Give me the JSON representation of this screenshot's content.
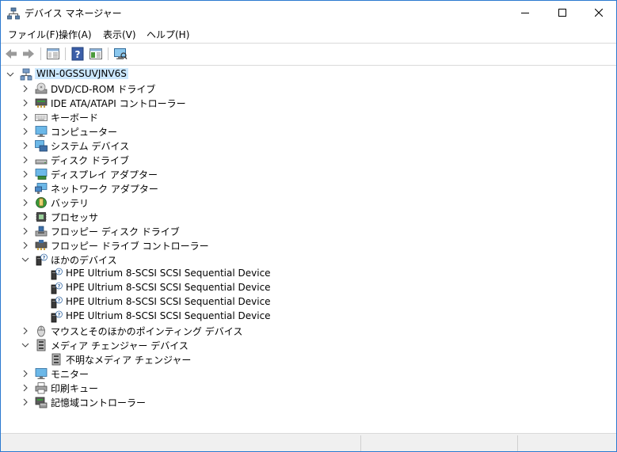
{
  "window": {
    "title": "デバイス マネージャー"
  },
  "menu": [
    "ファイル(F)",
    "操作(A)",
    "表示(V)",
    "ヘルプ(H)"
  ],
  "tree": {
    "root": "WIN-0GSSUVJNV6S",
    "items": [
      {
        "label": "DVD/CD-ROM ドライブ",
        "icon": "dvd-drive-icon",
        "expanded": false
      },
      {
        "label": "IDE ATA/ATAPI コントローラー",
        "icon": "ide-controller-icon",
        "expanded": false
      },
      {
        "label": "キーボード",
        "icon": "keyboard-icon",
        "expanded": false
      },
      {
        "label": "コンピューター",
        "icon": "computer-icon",
        "expanded": false
      },
      {
        "label": "システム デバイス",
        "icon": "system-devices-icon",
        "expanded": false
      },
      {
        "label": "ディスク ドライブ",
        "icon": "disk-drive-icon",
        "expanded": false
      },
      {
        "label": "ディスプレイ アダプター",
        "icon": "display-adapter-icon",
        "expanded": false
      },
      {
        "label": "ネットワーク アダプター",
        "icon": "network-adapter-icon",
        "expanded": false
      },
      {
        "label": "バッテリ",
        "icon": "battery-icon",
        "expanded": false
      },
      {
        "label": "プロセッサ",
        "icon": "processor-icon",
        "expanded": false
      },
      {
        "label": "フロッピー ディスク ドライブ",
        "icon": "floppy-drive-icon",
        "expanded": false
      },
      {
        "label": "フロッピー ドライブ コントローラー",
        "icon": "floppy-controller-icon",
        "expanded": false
      },
      {
        "label": "ほかのデバイス",
        "icon": "unknown-device-icon",
        "expanded": true,
        "children": [
          "HPE Ultrium 8-SCSI SCSI Sequential Device",
          "HPE Ultrium 8-SCSI SCSI Sequential Device",
          "HPE Ultrium 8-SCSI SCSI Sequential Device",
          "HPE Ultrium 8-SCSI SCSI Sequential Device"
        ]
      },
      {
        "label": "マウスとそのほかのポインティング デバイス",
        "icon": "mouse-icon",
        "expanded": false
      },
      {
        "label": "メディア チェンジャー デバイス",
        "icon": "media-changer-icon",
        "expanded": true,
        "children": [
          "不明なメディア チェンジャー"
        ]
      },
      {
        "label": "モニター",
        "icon": "monitor-icon",
        "expanded": false
      },
      {
        "label": "印刷キュー",
        "icon": "printer-icon",
        "expanded": false
      },
      {
        "label": "記憶域コントローラー",
        "icon": "storage-controller-icon",
        "expanded": false
      }
    ]
  }
}
